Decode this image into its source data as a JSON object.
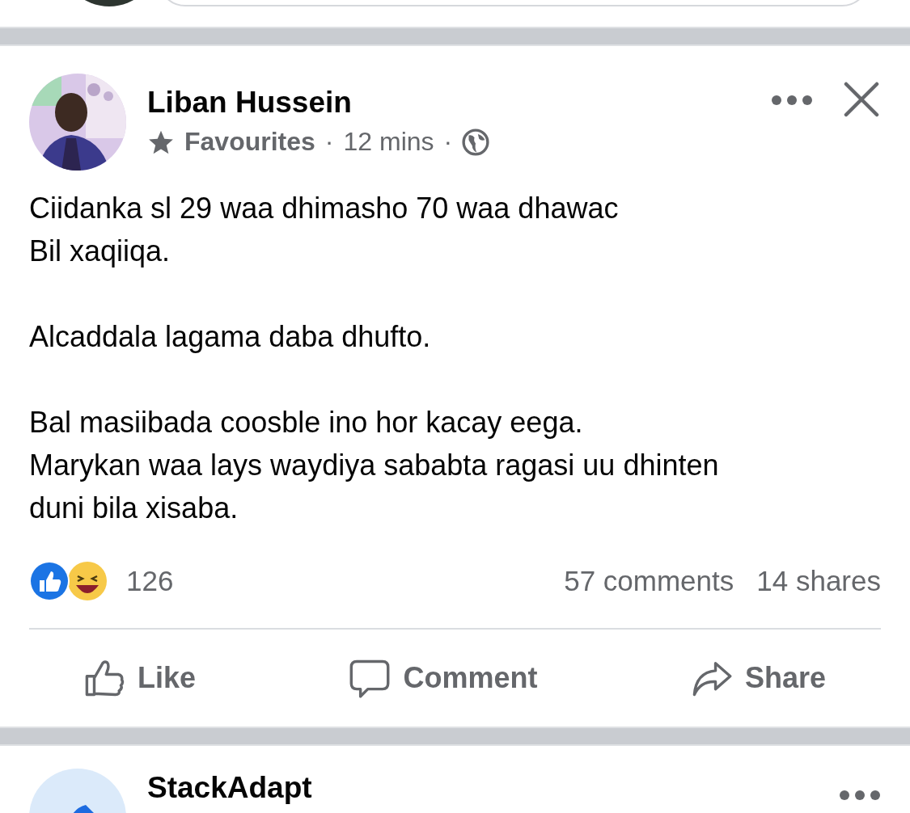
{
  "post": {
    "author": "Liban Hussein",
    "audience_label": "Favourites",
    "time": "12 mins",
    "separator": "·",
    "paragraphs": [
      [
        "Ciidanka sl 29 waa dhimasho 70 waa dhawac",
        "Bil xaqiiqa."
      ],
      [
        "Alcaddala lagama daba dhufto."
      ],
      [
        "Bal masiibada coosble ino hor kacay eega.",
        "Marykan waa lays waydiya sababta ragasi uu dhinten",
        "duni bila xisaba."
      ]
    ],
    "reaction_count": "126",
    "comments": "57 comments",
    "shares": "14 shares",
    "actions": [
      {
        "kind": "like",
        "label": "Like"
      },
      {
        "kind": "comment",
        "label": "Comment"
      },
      {
        "kind": "share",
        "label": "Share"
      }
    ]
  },
  "next_post": {
    "author": "StackAdapt"
  }
}
